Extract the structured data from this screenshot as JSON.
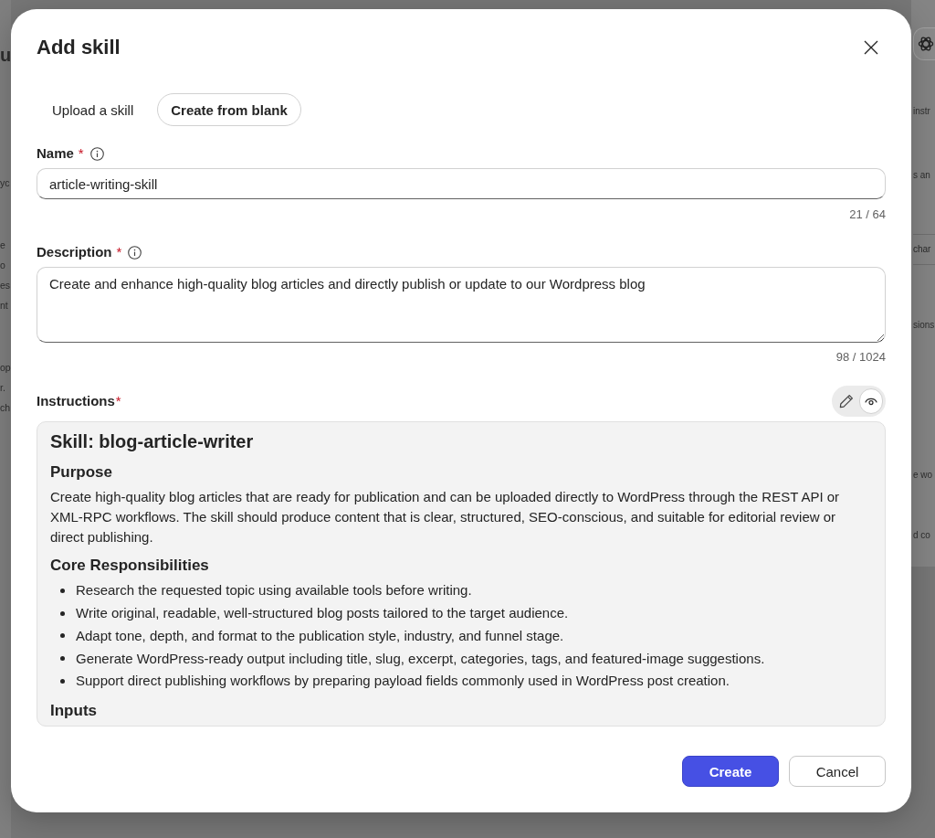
{
  "background": {
    "left": [
      {
        "kind": "heading",
        "lines": [
          "u"
        ]
      },
      {
        "kind": "paragraph",
        "lines": [
          "yc"
        ]
      },
      {
        "kind": "paragraph",
        "lines": [
          "e",
          "o",
          "es",
          "nt"
        ]
      },
      {
        "kind": "paragraph",
        "lines": [
          "op",
          "r.",
          "ch"
        ]
      }
    ],
    "right": [
      {
        "kind": "logo_button"
      },
      {
        "kind": "text",
        "text": "instr"
      },
      {
        "kind": "text",
        "text": "s an"
      },
      {
        "kind": "strip",
        "text": "char"
      },
      {
        "kind": "text",
        "text": "sions"
      },
      {
        "kind": "text",
        "text": "e wo"
      },
      {
        "kind": "text",
        "text": "d co"
      }
    ]
  },
  "dialog": {
    "title": "Add skill",
    "tabs": [
      {
        "label": "Upload a skill",
        "selected": false
      },
      {
        "label": "Create from blank",
        "selected": true
      }
    ],
    "fields": [
      {
        "kind": "input",
        "label": "Name",
        "required_mark": "*",
        "info": true,
        "value": "article-writing-skill",
        "counter": "21 / 64"
      },
      {
        "kind": "textarea",
        "label": "Description",
        "required_mark": "*",
        "info": true,
        "value": "Create and enhance high-quality blog articles and directly publish or update to our Wordpress blog",
        "counter": "98 / 1024"
      }
    ],
    "instructions": {
      "label": "Instructions",
      "required_mark": "*",
      "view_modes": [
        {
          "kind": "edit",
          "selected": false
        },
        {
          "kind": "preview",
          "selected": true
        }
      ],
      "content": [
        {
          "kind": "h1",
          "text": "Skill: blog-article-writer"
        },
        {
          "kind": "h2",
          "text": "Purpose"
        },
        {
          "kind": "paragraph",
          "text": "Create high-quality blog articles that are ready for publication and can be uploaded directly to WordPress through the REST API or XML-RPC workflows. The skill should produce content that is clear, structured, SEO-conscious, and suitable for editorial review or direct publishing."
        },
        {
          "kind": "h2",
          "text": "Core Responsibilities"
        },
        {
          "kind": "list",
          "items": [
            "Research the requested topic using available tools before writing.",
            "Write original, readable, well-structured blog posts tailored to the target audience.",
            "Adapt tone, depth, and format to the publication style, industry, and funnel stage.",
            "Generate WordPress-ready output including title, slug, excerpt, categories, tags, and featured-image suggestions.",
            "Support direct publishing workflows by preparing payload fields commonly used in WordPress post creation."
          ]
        },
        {
          "kind": "h2",
          "text": "Inputs"
        }
      ]
    },
    "buttons": [
      {
        "kind": "primary",
        "label": "Create"
      },
      {
        "kind": "secondary",
        "label": "Cancel"
      }
    ]
  }
}
